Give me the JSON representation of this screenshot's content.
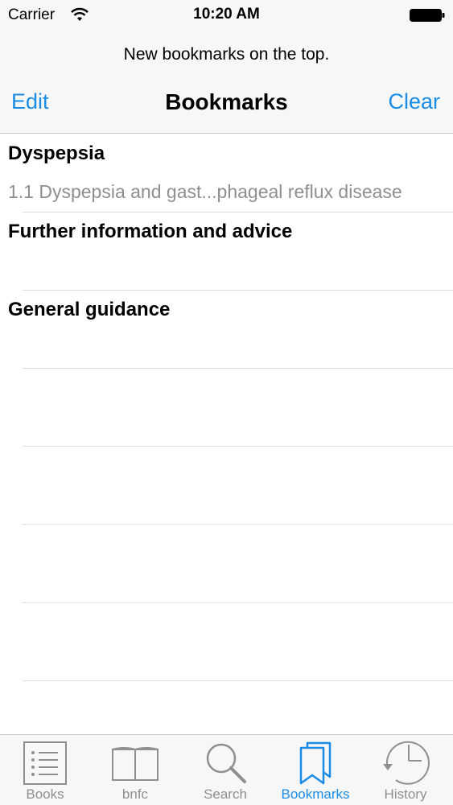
{
  "status_bar": {
    "carrier": "Carrier",
    "time": "10:20 AM"
  },
  "prompt": "New bookmarks on the top.",
  "nav": {
    "edit_label": "Edit",
    "title": "Bookmarks",
    "clear_label": "Clear"
  },
  "bookmarks": [
    {
      "heading": "Dyspepsia",
      "subtitle": "1.1 Dyspepsia and gast...phageal reflux disease"
    },
    {
      "heading": "Further information and advice",
      "subtitle": ""
    },
    {
      "heading": "General guidance",
      "subtitle": ""
    }
  ],
  "tabs": [
    {
      "label": "Books",
      "icon": "list-icon",
      "active": false
    },
    {
      "label": "bnfc",
      "icon": "open-book-icon",
      "active": false
    },
    {
      "label": "Search",
      "icon": "magnifier-icon",
      "active": false
    },
    {
      "label": "Bookmarks",
      "icon": "bookmarks-icon",
      "active": true
    },
    {
      "label": "History",
      "icon": "clock-history-icon",
      "active": false
    }
  ],
  "colors": {
    "accent": "#1a8ce6",
    "inactive": "#8e8e93",
    "bar_bg": "#f7f7f7",
    "separator": "#d9d9de"
  }
}
